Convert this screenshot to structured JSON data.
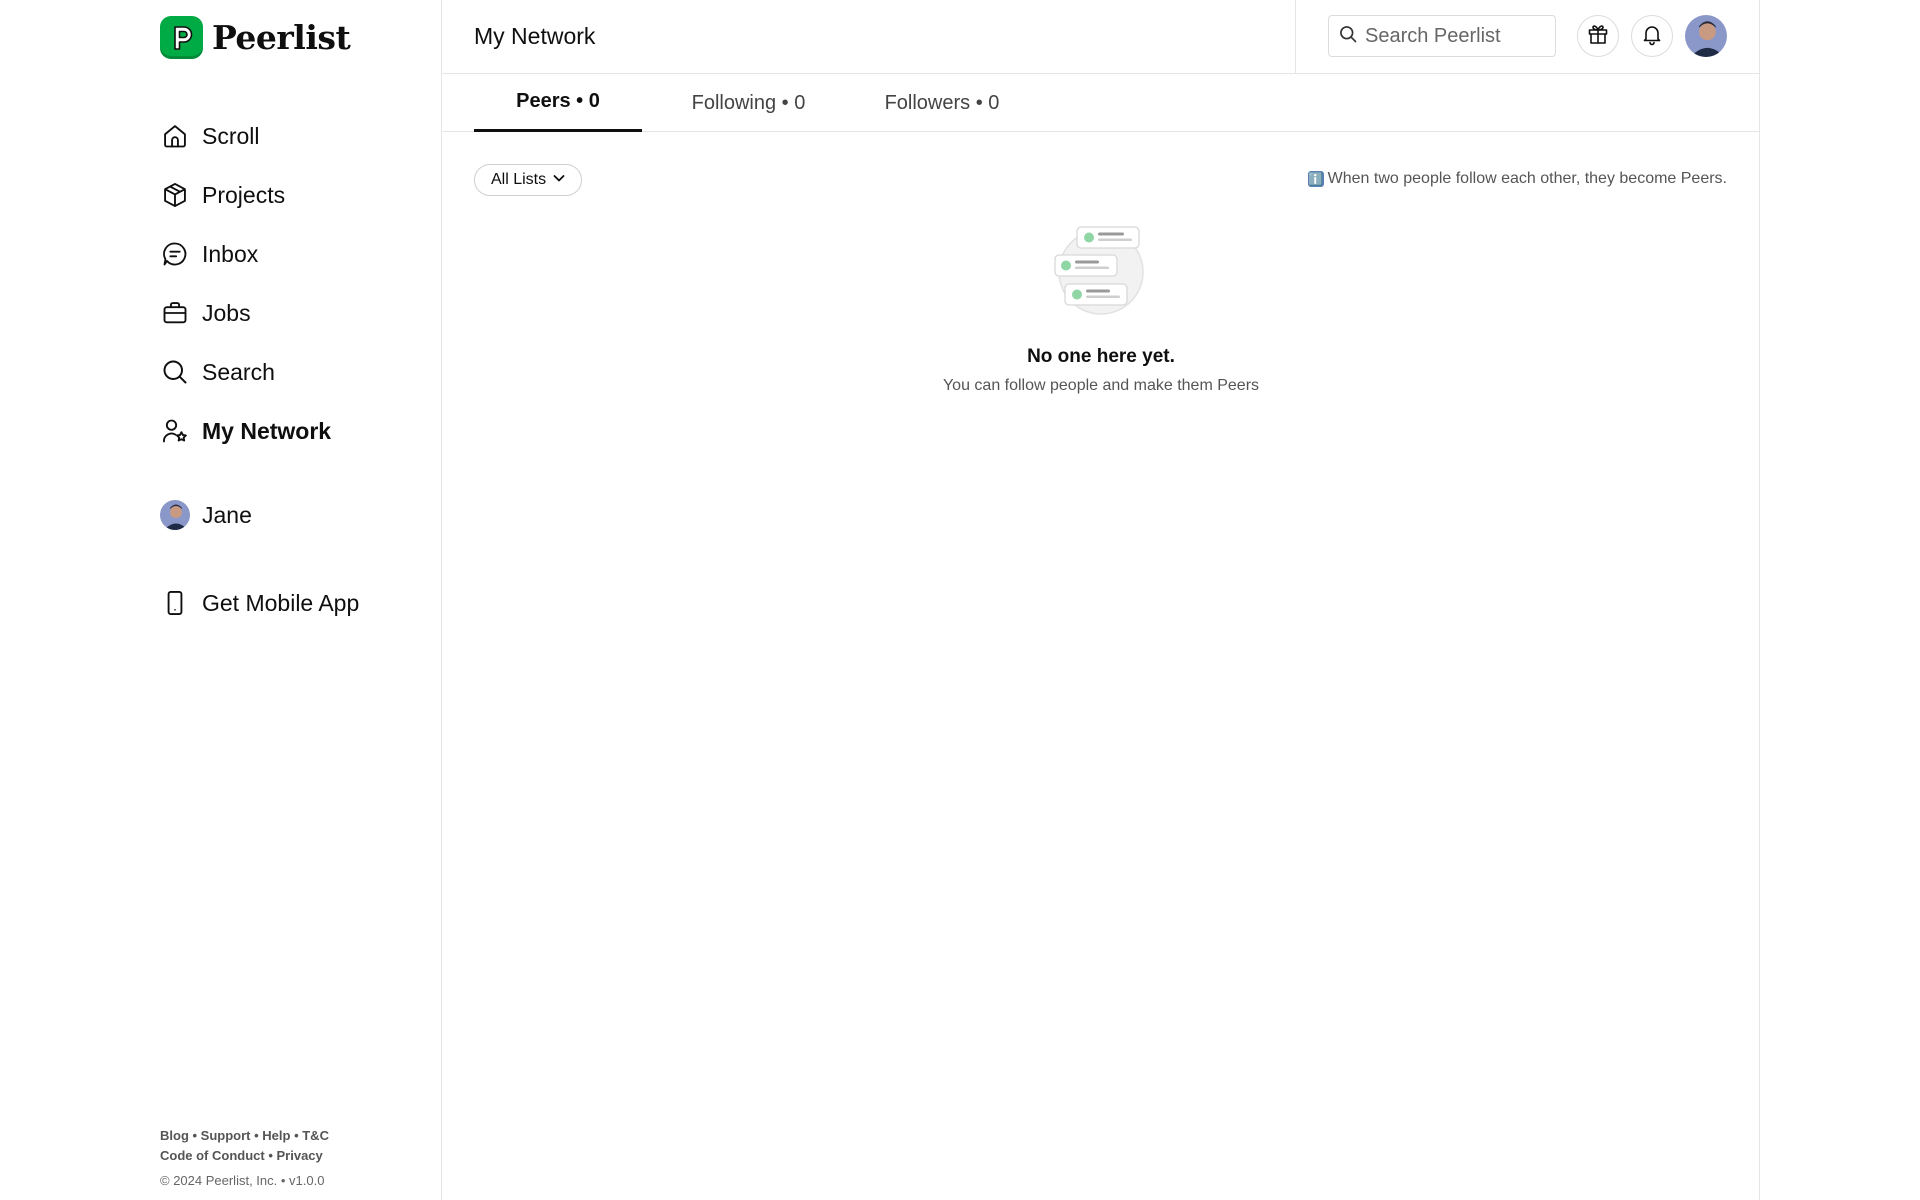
{
  "brand": {
    "name": "Peerlist",
    "logo_letter": "P",
    "color": "#00aa45"
  },
  "sidebar": {
    "items": [
      {
        "label": "Scroll",
        "icon": "home-icon"
      },
      {
        "label": "Projects",
        "icon": "cube-icon"
      },
      {
        "label": "Inbox",
        "icon": "chat-icon"
      },
      {
        "label": "Jobs",
        "icon": "briefcase-icon"
      },
      {
        "label": "Search",
        "icon": "search-icon"
      },
      {
        "label": "My Network",
        "icon": "network-icon",
        "active": true
      }
    ],
    "profile": {
      "label": "Jane",
      "icon": "avatar"
    },
    "mobile_app": {
      "label": "Get Mobile App",
      "icon": "phone-icon"
    }
  },
  "footer": {
    "links_line1": [
      "Blog",
      "Support",
      "Help",
      "T&C"
    ],
    "links_line2": [
      "Code of Conduct",
      "Privacy"
    ],
    "separator": " • ",
    "copyright": "© 2024 Peerlist, Inc. • v1.0.0"
  },
  "header": {
    "title": "My Network",
    "search_placeholder": "Search Peerlist",
    "gift_icon": "gift-icon",
    "bell_icon": "bell-icon"
  },
  "tabs": [
    {
      "label": "Peers • 0",
      "active": true
    },
    {
      "label": "Following • 0",
      "active": false
    },
    {
      "label": "Followers • 0",
      "active": false
    }
  ],
  "filter": {
    "selected": "All Lists"
  },
  "info_note": {
    "icon": "ℹ️",
    "text": "When two people follow each other, they become Peers."
  },
  "empty_state": {
    "title": "No one here yet.",
    "subtitle": "You can follow people and make them Peers"
  }
}
